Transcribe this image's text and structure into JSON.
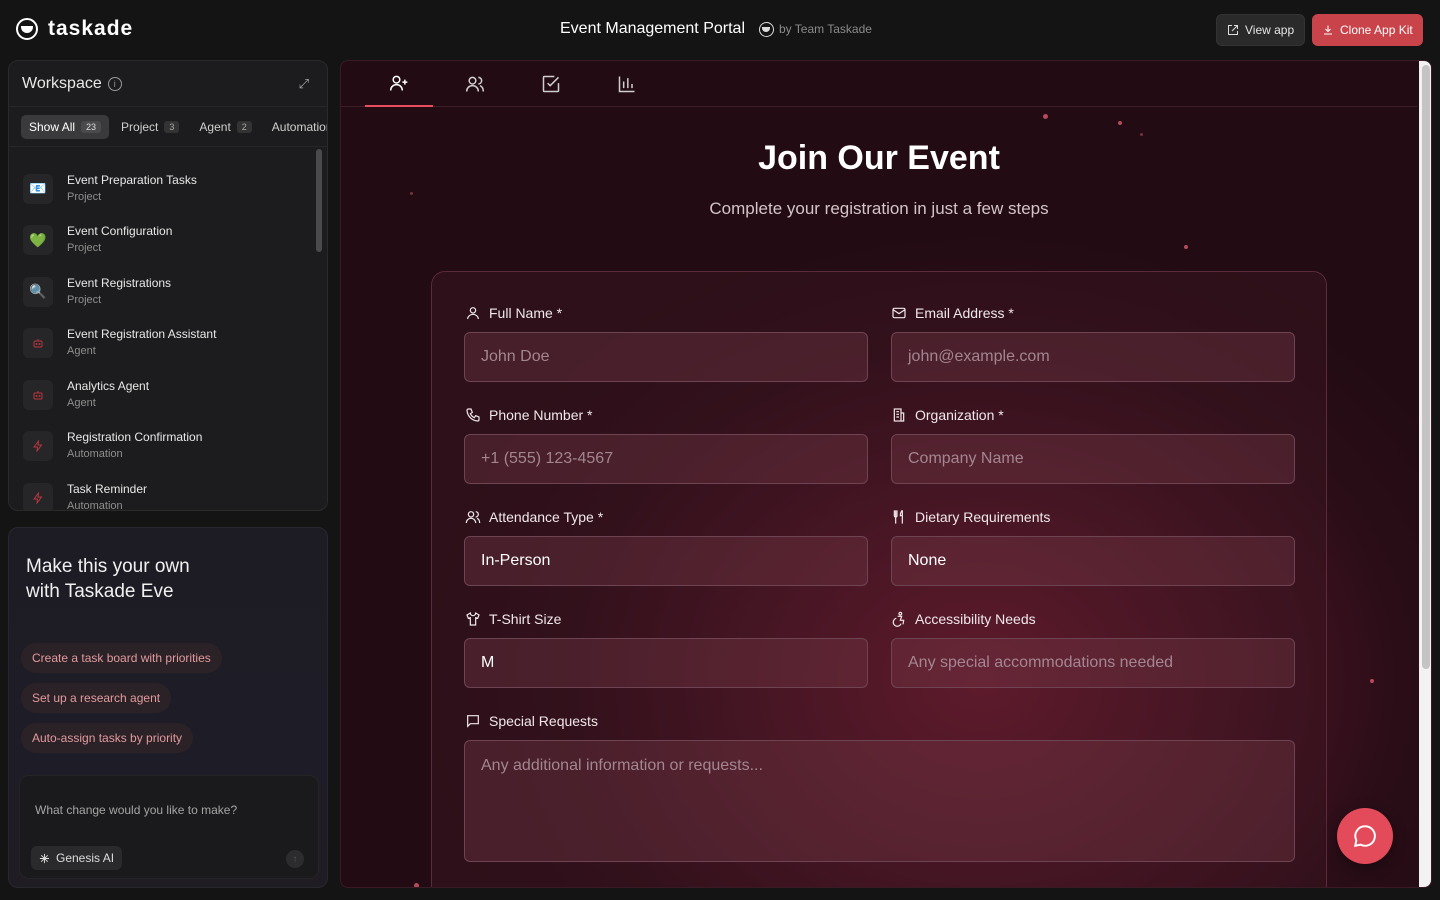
{
  "brand": {
    "name": "taskade"
  },
  "header": {
    "title": "Event Management Portal",
    "by": "by Team Taskade",
    "view_app": "View app",
    "clone": "Clone App Kit"
  },
  "workspace": {
    "title": "Workspace",
    "tabs": [
      {
        "label": "Show All",
        "count": "23"
      },
      {
        "label": "Project",
        "count": "3"
      },
      {
        "label": "Agent",
        "count": "2"
      },
      {
        "label": "Automation",
        "count": ""
      }
    ],
    "items": [
      {
        "name": "Event Preparation Tasks",
        "type": "Project",
        "icon": "📧"
      },
      {
        "name": "Event Configuration",
        "type": "Project",
        "icon": "💚"
      },
      {
        "name": "Event Registrations",
        "type": "Project",
        "icon": "🔍"
      },
      {
        "name": "Event Registration Assistant",
        "type": "Agent",
        "icon": "robot-icon"
      },
      {
        "name": "Analytics Agent",
        "type": "Agent",
        "icon": "robot-icon"
      },
      {
        "name": "Registration Confirmation",
        "type": "Automation",
        "icon": "bolt-icon"
      },
      {
        "name": "Task Reminder",
        "type": "Automation",
        "icon": "bolt-icon"
      }
    ]
  },
  "eve": {
    "title": "Make this your own with Taskade Eve",
    "chips": [
      "Create a task board with priorities",
      "Set up a research agent",
      "Auto-assign tasks by priority"
    ],
    "prompt_placeholder": "What change would you like to make?",
    "genesis": "Genesis AI"
  },
  "form": {
    "heading": "Join Our Event",
    "subheading": "Complete your registration in just a few steps",
    "full_name": {
      "label": "Full Name *",
      "placeholder": "John Doe"
    },
    "email": {
      "label": "Email Address *",
      "placeholder": "john@example.com"
    },
    "phone": {
      "label": "Phone Number *",
      "placeholder": "+1 (555) 123-4567"
    },
    "organization": {
      "label": "Organization *",
      "placeholder": "Company Name"
    },
    "attendance": {
      "label": "Attendance Type *",
      "value": "In-Person"
    },
    "dietary": {
      "label": "Dietary Requirements",
      "value": "None"
    },
    "tshirt": {
      "label": "T-Shirt Size",
      "value": "M"
    },
    "accessibility": {
      "label": "Accessibility Needs",
      "placeholder": "Any special accommodations needed"
    },
    "special": {
      "label": "Special Requests",
      "placeholder": "Any additional information or requests..."
    }
  },
  "colors": {
    "accent": "#e34a5a",
    "clone_button": "#c9434a"
  }
}
